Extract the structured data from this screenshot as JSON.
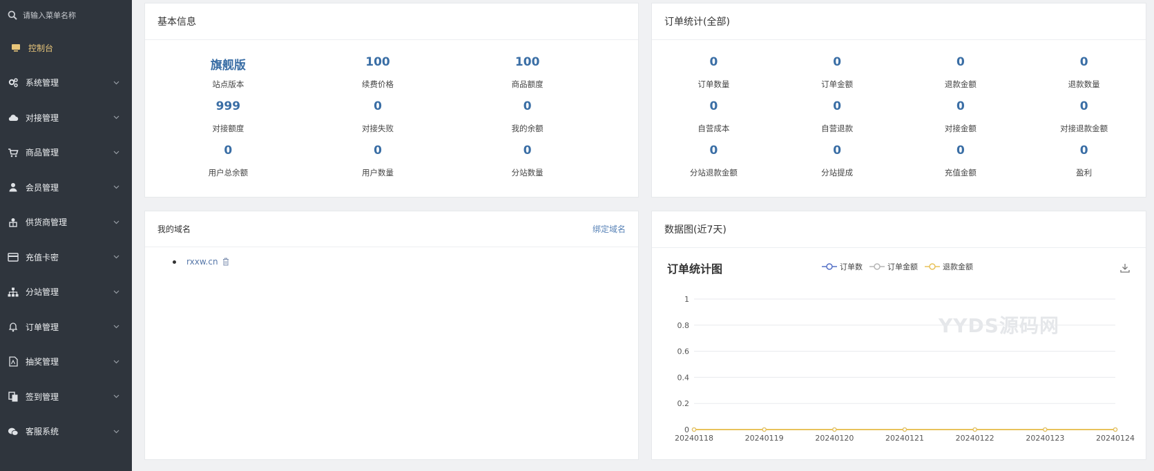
{
  "sidebar": {
    "search_placeholder": "请输入菜单名称",
    "items": [
      {
        "label": "控制台",
        "icon": "monitor-icon",
        "active": true
      },
      {
        "label": "系统管理",
        "icon": "gears-icon"
      },
      {
        "label": "对接管理",
        "icon": "cloud-icon"
      },
      {
        "label": "商品管理",
        "icon": "cart-icon"
      },
      {
        "label": "会员管理",
        "icon": "user-icon"
      },
      {
        "label": "供货商管理",
        "icon": "supplier-icon"
      },
      {
        "label": "充值卡密",
        "icon": "card-icon"
      },
      {
        "label": "分站管理",
        "icon": "sitemap-icon"
      },
      {
        "label": "订单管理",
        "icon": "bell-icon"
      },
      {
        "label": "抽奖管理",
        "icon": "file-icon"
      },
      {
        "label": "签到管理",
        "icon": "copy-icon"
      },
      {
        "label": "客服系统",
        "icon": "wechat-icon"
      }
    ]
  },
  "basic_info": {
    "title": "基本信息",
    "stats": [
      {
        "value": "旗舰版",
        "label": "站点版本"
      },
      {
        "value": "100",
        "label": "续费价格"
      },
      {
        "value": "100",
        "label": "商品额度"
      },
      {
        "value": "999",
        "label": "对接额度"
      },
      {
        "value": "0",
        "label": "对接失败"
      },
      {
        "value": "0",
        "label": "我的余额"
      },
      {
        "value": "0",
        "label": "用户总余额"
      },
      {
        "value": "0",
        "label": "用户数量"
      },
      {
        "value": "0",
        "label": "分站数量"
      }
    ]
  },
  "order_stats": {
    "title": "订单统计(全部)",
    "stats": [
      {
        "value": "0",
        "label": "订单数量"
      },
      {
        "value": "0",
        "label": "订单金额"
      },
      {
        "value": "0",
        "label": "退款金额"
      },
      {
        "value": "0",
        "label": "退款数量"
      },
      {
        "value": "0",
        "label": "自营成本"
      },
      {
        "value": "0",
        "label": "自营退款"
      },
      {
        "value": "0",
        "label": "对接金额"
      },
      {
        "value": "0",
        "label": "对接退款金额"
      },
      {
        "value": "0",
        "label": "分站退款金额"
      },
      {
        "value": "0",
        "label": "分站提成"
      },
      {
        "value": "0",
        "label": "充值金额"
      },
      {
        "value": "0",
        "label": "盈利"
      }
    ]
  },
  "domains": {
    "title": "我的域名",
    "bind_label": "绑定域名",
    "list": [
      "rxxw.cn"
    ]
  },
  "chart_panel": {
    "title": "数据图(近7天)",
    "watermark": "YYDS源码网"
  },
  "colors": {
    "series_orders": "#5470c6",
    "series_amount": "#b5b5b5",
    "series_refund": "#e8c25a",
    "accent_value": "#3a6ea5"
  },
  "chart_data": {
    "type": "line",
    "title": "订单统计图",
    "x": [
      "20240118",
      "20240119",
      "20240120",
      "20240121",
      "20240122",
      "20240123",
      "20240124"
    ],
    "series": [
      {
        "name": "订单数",
        "values": [
          0,
          0,
          0,
          0,
          0,
          0,
          0
        ]
      },
      {
        "name": "订单金额",
        "values": [
          0,
          0,
          0,
          0,
          0,
          0,
          0
        ]
      },
      {
        "name": "退款金额",
        "values": [
          0,
          0,
          0,
          0,
          0,
          0,
          0
        ]
      }
    ],
    "yticks": [
      "0",
      "0.2",
      "0.4",
      "0.6",
      "0.8",
      "1"
    ],
    "ylim": [
      0,
      1
    ],
    "grid": true,
    "legend": "top-center"
  }
}
